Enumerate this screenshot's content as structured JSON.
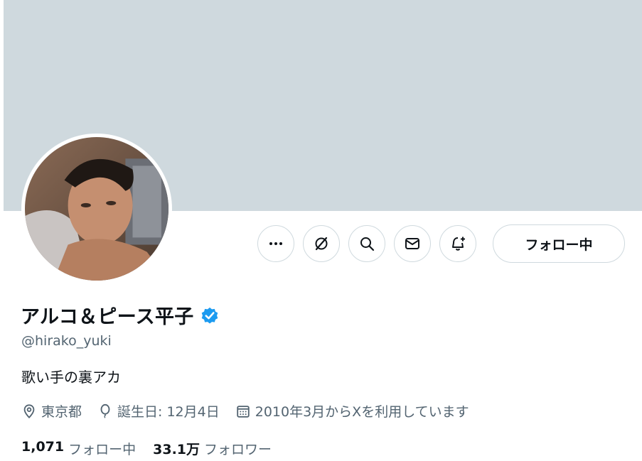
{
  "profile": {
    "name": "アルコ＆ピース平子",
    "handle": "@hirako_yuki",
    "bio": "歌い手の裏アカ",
    "location": "東京都",
    "birthday": "誕生日: 12月4日",
    "joined": "2010年3月からXを利用しています",
    "verified": true
  },
  "stats": {
    "following_count": "1,071",
    "following_label": "フォロー中",
    "followers_count": "33.1万",
    "followers_label": "フォロワー"
  },
  "actions": {
    "follow_label": "フォロー中",
    "icons": [
      "more-icon",
      "grok-icon",
      "search-icon",
      "mail-icon",
      "notification-add-icon"
    ]
  },
  "colors": {
    "banner": "#cfd9de",
    "secondary_text": "#536471",
    "verified": "#1d9bf0"
  }
}
